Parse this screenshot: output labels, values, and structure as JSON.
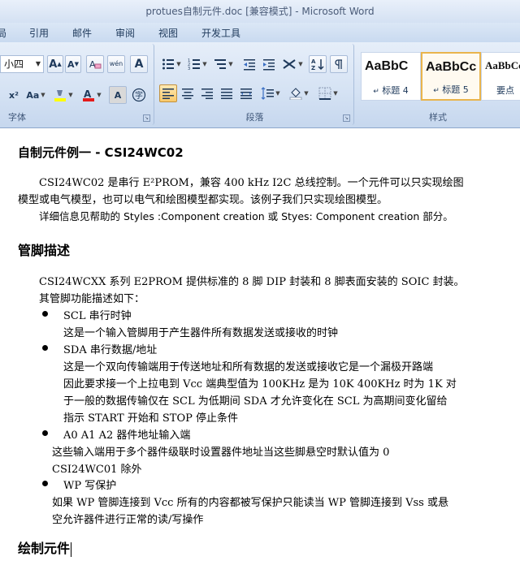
{
  "window": {
    "title": "protues自制元件.doc [兼容模式] - Microsoft Word"
  },
  "tabs": [
    "局",
    "引用",
    "邮件",
    "审阅",
    "视图",
    "开发工具"
  ],
  "font_group": {
    "size_value": "小四",
    "grow_label": "A",
    "shrink_label": "A",
    "phonetic_label": "wén",
    "enclose_label": "A",
    "superscript_label": "x²",
    "case_label": "Aa",
    "char_shade_label": "A",
    "enclosed_char_label": "字",
    "label": "字体"
  },
  "paragraph_group": {
    "label": "段落"
  },
  "styles_group": {
    "label": "样式",
    "tiles": [
      {
        "sample": "AaBbC",
        "name": "标题 4"
      },
      {
        "sample": "AaBbCc",
        "name": "标题 5"
      },
      {
        "sample": "AaBbCc",
        "name": "要点"
      }
    ]
  },
  "document": {
    "title": "自制元件例一 - CSI24WC02",
    "intro": [
      "CSI24WC02 是串行 E²PROM，兼容 400 kHz I2C 总线控制。一个元件可以只实现绘图",
      "模型或电气模型，也可以电气和绘图模型都实现。该例子我们只实现绘图模型。",
      "详细信息见帮助的 Styles :Component creation 或 Styes: Component creation 部分。"
    ],
    "section1": "管脚描述",
    "desc": [
      "CSI24WCXX 系列 E2PROM 提供标准的 8 脚 DIP 封装和 8 脚表面安装的 SOIC 封装。",
      "其管脚功能描述如下："
    ],
    "pins": [
      {
        "name": "SCL 串行时钟",
        "lines": [
          "这是一个输入管脚用于产生器件所有数据发送或接收的时钟"
        ]
      },
      {
        "name": "SDA 串行数据/地址",
        "lines": [
          "这是一个双向传输端用于传送地址和所有数据的发送或接收它是一个漏极开路端",
          "因此要求接一个上拉电到 Vcc  端典型值为 100KHz  是为 10K 400KHz 时为 1K  对",
          "于一般的数据传输仅在 SCL 为低期间 SDA 才允许变化在 SCL 为高期间变化留给",
          "指示 START 开始和 STOP 停止条件"
        ]
      },
      {
        "name": "A0 A1 A2  器件地址输入端",
        "lines": [
          "这些输入端用于多个器件级联时设置器件地址当这些脚悬空时默认值为   0",
          "CSI24WC01 除外"
        ]
      },
      {
        "name": "WP 写保护",
        "lines": [
          "如果 WP 管脚连接到 Vcc 所有的内容都被写保护只能读当 WP 管脚连接到 Vss 或悬",
          "空允许器件进行正常的读/写操作"
        ]
      }
    ],
    "section2": "绘制元件"
  }
}
